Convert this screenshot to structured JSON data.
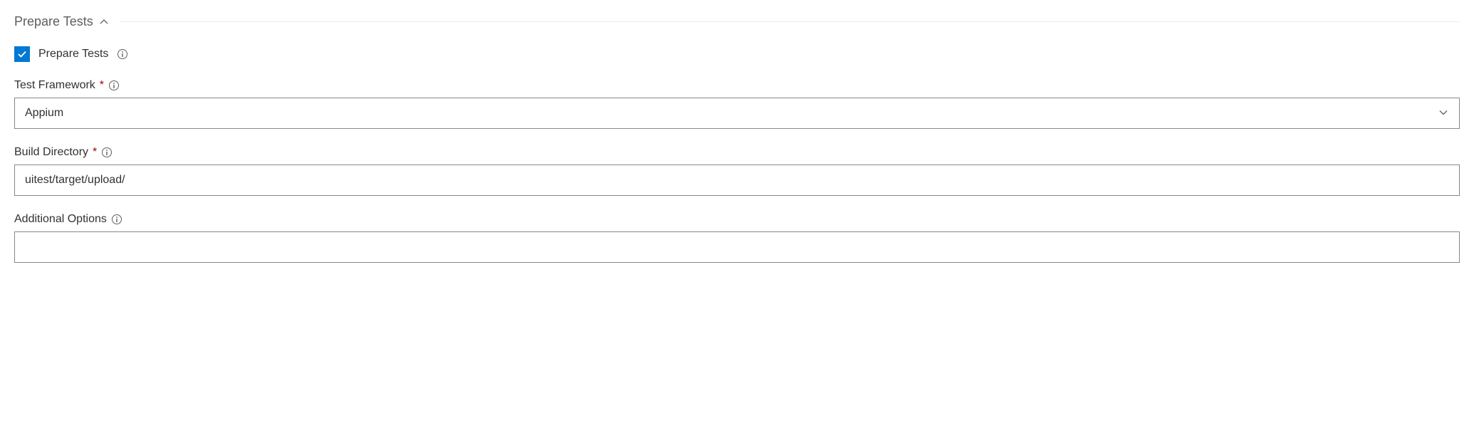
{
  "section": {
    "title": "Prepare Tests"
  },
  "checkbox": {
    "label": "Prepare Tests",
    "checked": true
  },
  "fields": {
    "testFramework": {
      "label": "Test Framework",
      "required": true,
      "value": "Appium"
    },
    "buildDirectory": {
      "label": "Build Directory",
      "required": true,
      "value": "uitest/target/upload/"
    },
    "additionalOptions": {
      "label": "Additional Options",
      "required": false,
      "value": ""
    }
  }
}
